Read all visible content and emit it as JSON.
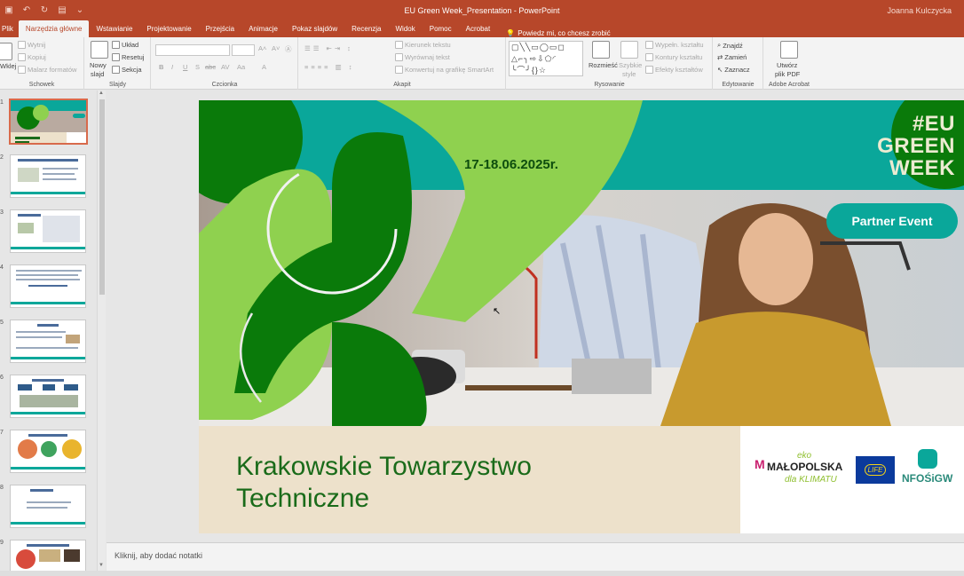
{
  "window": {
    "title": "EU Green Week_Presentation  -  PowerPoint",
    "user": "Joanna Kulczycka"
  },
  "tabs": [
    {
      "label": "Plik"
    },
    {
      "label": "Narzędzia główne"
    },
    {
      "label": "Wstawianie"
    },
    {
      "label": "Projektowanie"
    },
    {
      "label": "Przejścia"
    },
    {
      "label": "Animacje"
    },
    {
      "label": "Pokaz slajdów"
    },
    {
      "label": "Recenzja"
    },
    {
      "label": "Widok"
    },
    {
      "label": "Pomoc"
    },
    {
      "label": "Acrobat"
    }
  ],
  "tell_me": "Powiedz mi, co chcesz zrobić",
  "ribbon": {
    "clipboard": {
      "label": "Schowek",
      "paste": "Wklej",
      "cut": "Wytnij",
      "copy": "Kopiuj",
      "format_painter": "Malarz formatów"
    },
    "slides": {
      "label": "Slajdy",
      "new_slide_1": "Nowy",
      "new_slide_2": "slajd",
      "layout": "Układ",
      "reset": "Resetuj",
      "section": "Sekcja"
    },
    "font": {
      "label": "Czcionka",
      "bold": "B",
      "italic": "I",
      "underline": "U",
      "shadow": "S",
      "strike": "abc",
      "spacing": "AV",
      "case": "Aa",
      "color": "A"
    },
    "paragraph": {
      "label": "Akapit",
      "text_direction": "Kierunek tekstu",
      "align_text": "Wyrównaj tekst",
      "smartart": "Konwertuj na grafikę SmartArt"
    },
    "drawing": {
      "label": "Rysowanie",
      "shape_row_1": "▢╲╲▭◯▭◻",
      "shape_row_2": "△⌐╮⇨⇩⬠◜",
      "shape_row_3": "╰⌒╯{}☆",
      "arrange": "Rozmieść",
      "quick_styles_1": "Szybkie",
      "quick_styles_2": "style",
      "shape_fill": "Wypełn. kształtu",
      "shape_outline": "Kontury kształtu",
      "shape_effects": "Efekty kształtów"
    },
    "editing": {
      "label": "Edytowanie",
      "find": "Znajdź",
      "replace": "Zamień",
      "select": "Zaznacz"
    },
    "acrobat": {
      "label": "Adobe Acrobat",
      "create_pdf_1": "Utwórz",
      "create_pdf_2": "plik PDF"
    }
  },
  "thumbnails": [
    {
      "number": "1"
    },
    {
      "number": "2"
    },
    {
      "number": "3"
    },
    {
      "number": "4"
    },
    {
      "number": "5"
    },
    {
      "number": "6"
    },
    {
      "number": "7"
    },
    {
      "number": "8"
    },
    {
      "number": "9"
    }
  ],
  "slide": {
    "date": "17-18.06.2025r.",
    "hashtag_line1": "#EU",
    "hashtag_line2": "GREEN",
    "hashtag_line3": "WEEK",
    "partner_event": "Partner Event",
    "title_line1": "Krakowskie Towarzystwo",
    "title_line2": "Techniczne",
    "logo_eko": "eko",
    "logo_malopolska": "MAŁOPOLSKA",
    "logo_dla_klimatu": "dla KLIMATU",
    "logo_life": "LIFE",
    "logo_nfosigw": "NFOŚiGW"
  },
  "notes_placeholder": "Kliknij, aby dodać notatki",
  "colors": {
    "accent": "#b7472a",
    "teal": "#0aa79a",
    "dark_green": "#0a7a0a",
    "light_green": "#8fd14f",
    "beige": "#ede1cb"
  }
}
